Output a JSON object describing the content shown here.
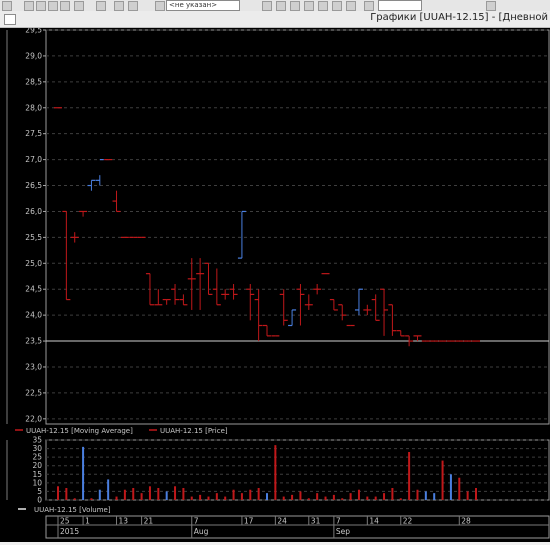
{
  "toolbar": {
    "combo_text": "<не указан>"
  },
  "window": {
    "title": "Графики [UUAH-12.15] - [Дневной"
  },
  "chart_data": [
    {
      "type": "ohlc",
      "title": "",
      "ylim": [
        21.9,
        29.5
      ],
      "y_ticks": [
        "29,5",
        "29,0",
        "28,5",
        "28,0",
        "27,5",
        "27,0",
        "26,5",
        "26,0",
        "25,5",
        "25,0",
        "24,5",
        "24,0",
        "23,5",
        "23,0",
        "22,5",
        "22,0"
      ],
      "reference_line": 23.5,
      "up_color": "#4a7fe0",
      "down_color": "#c0181a",
      "x": [
        "2015-05-25",
        "2015-05-26",
        "2015-05-27",
        "2015-06-01",
        "2015-06-08",
        "2015-06-10",
        "2015-06-12",
        "2015-06-15",
        "2015-06-18",
        "2015-06-22",
        "2015-06-25",
        "2015-06-29",
        "2015-07-01",
        "2015-07-03",
        "2015-07-06",
        "2015-07-07",
        "2015-07-09",
        "2015-07-13",
        "2015-07-14",
        "2015-07-16",
        "2015-07-20",
        "2015-07-22",
        "2015-07-24",
        "2015-07-27",
        "2015-07-29",
        "2015-07-31",
        "2015-08-05",
        "2015-08-07",
        "2015-08-10",
        "2015-08-12",
        "2015-08-14",
        "2015-08-17",
        "2015-08-19",
        "2015-08-21",
        "2015-08-24",
        "2015-08-26",
        "2015-08-28",
        "2015-08-31",
        "2015-09-02",
        "2015-09-04",
        "2015-09-07",
        "2015-09-09",
        "2015-09-11",
        "2015-09-14",
        "2015-09-16",
        "2015-09-18",
        "2015-09-21",
        "2015-09-23",
        "2015-09-25",
        "2015-09-28",
        "2015-09-30"
      ],
      "series": [
        {
          "name": "UUAH-12.15 [Price]",
          "open": [
            28.0,
            26.0,
            25.5,
            26.0,
            26.5,
            26.6,
            27.0,
            26.2,
            25.5,
            25.5,
            25.5,
            24.8,
            24.2,
            24.3,
            24.5,
            24.3,
            24.7,
            24.8,
            25.0,
            24.5,
            24.4,
            24.5,
            25.1,
            24.5,
            24.3,
            23.8,
            23.6,
            24.4,
            23.8,
            24.5,
            24.2,
            24.5,
            24.8,
            24.3,
            24.2,
            23.8,
            24.1,
            24.1,
            24.3,
            24.5,
            24.2,
            23.7,
            23.6,
            23.6,
            23.5,
            23.5,
            23.5,
            23.5,
            23.5,
            23.5,
            23.5
          ],
          "high": [
            28.0,
            26.0,
            25.6,
            26.0,
            26.6,
            26.7,
            27.0,
            26.4,
            25.5,
            25.5,
            25.5,
            24.8,
            24.5,
            24.3,
            24.6,
            24.4,
            25.1,
            25.1,
            25.0,
            24.9,
            24.5,
            24.6,
            26.0,
            24.6,
            24.5,
            23.8,
            23.6,
            24.5,
            24.1,
            24.6,
            24.4,
            24.6,
            24.8,
            24.3,
            24.2,
            23.8,
            24.5,
            24.2,
            24.4,
            24.5,
            24.2,
            23.7,
            23.6,
            23.6,
            23.5,
            23.5,
            23.5,
            23.5,
            23.5,
            23.5,
            23.5
          ],
          "low": [
            28.0,
            24.3,
            25.4,
            25.9,
            26.4,
            26.5,
            27.0,
            26.0,
            25.5,
            25.5,
            25.5,
            24.2,
            24.2,
            24.2,
            24.2,
            24.2,
            24.1,
            24.1,
            24.4,
            24.2,
            24.3,
            24.3,
            25.1,
            23.9,
            23.5,
            23.6,
            23.6,
            23.8,
            23.8,
            23.8,
            24.1,
            24.4,
            24.8,
            24.1,
            23.9,
            23.8,
            24.0,
            24.0,
            23.9,
            23.6,
            23.6,
            23.6,
            23.4,
            23.5,
            23.5,
            23.5,
            23.5,
            23.5,
            23.5,
            23.5,
            23.5
          ],
          "close": [
            28.0,
            24.3,
            25.5,
            26.0,
            26.6,
            27.0,
            27.0,
            26.0,
            25.5,
            25.5,
            25.5,
            24.2,
            24.2,
            24.3,
            24.3,
            24.2,
            24.7,
            24.8,
            24.4,
            24.2,
            24.4,
            24.4,
            26.0,
            24.4,
            23.8,
            23.6,
            23.6,
            23.9,
            24.1,
            24.4,
            24.2,
            24.5,
            24.8,
            24.1,
            24.0,
            23.8,
            24.5,
            24.1,
            23.9,
            24.1,
            23.7,
            23.6,
            23.5,
            23.6,
            23.5,
            23.5,
            23.5,
            23.5,
            23.5,
            23.5,
            23.5
          ]
        },
        {
          "name": "UUAH-12.15 [Moving Average]",
          "values": []
        }
      ],
      "legend": [
        "UUAH-12.15 [Moving Average]",
        "UUAH-12.15 [Price]"
      ],
      "grid": true
    },
    {
      "type": "bar",
      "title": "",
      "ylim": [
        0,
        35
      ],
      "y_ticks": [
        "35",
        "30",
        "25",
        "20",
        "15",
        "10",
        "5",
        "0"
      ],
      "values": [
        8,
        7,
        1,
        31,
        1,
        6,
        12,
        2,
        6,
        7,
        4,
        8,
        7,
        5,
        8,
        7,
        2,
        3,
        2,
        4,
        2,
        6,
        4,
        6,
        7,
        4,
        32,
        2,
        3,
        5,
        1,
        4,
        2,
        3,
        1,
        4,
        6,
        2,
        2,
        4,
        7,
        1,
        28,
        6,
        5,
        4,
        23,
        15,
        13,
        5,
        7
      ],
      "colors": [
        "r",
        "r",
        "r",
        "b",
        "r",
        "b",
        "b",
        "r",
        "r",
        "r",
        "r",
        "r",
        "r",
        "b",
        "r",
        "r",
        "r",
        "r",
        "r",
        "r",
        "r",
        "r",
        "r",
        "r",
        "r",
        "b",
        "r",
        "r",
        "r",
        "r",
        "r",
        "r",
        "r",
        "r",
        "r",
        "r",
        "r",
        "r",
        "r",
        "r",
        "r",
        "r",
        "r",
        "r",
        "b",
        "b",
        "r",
        "b",
        "r",
        "r",
        "r"
      ],
      "legend": [
        "UUAH-12.15 [Volume]"
      ],
      "grid": true
    }
  ],
  "xaxis": {
    "day_labels": [
      "25",
      "1",
      "13",
      "21",
      "7",
      "17",
      "24",
      "31",
      "7",
      "14",
      "22",
      "28"
    ],
    "period_labels": [
      "2015",
      "Aug",
      "Sep"
    ]
  }
}
